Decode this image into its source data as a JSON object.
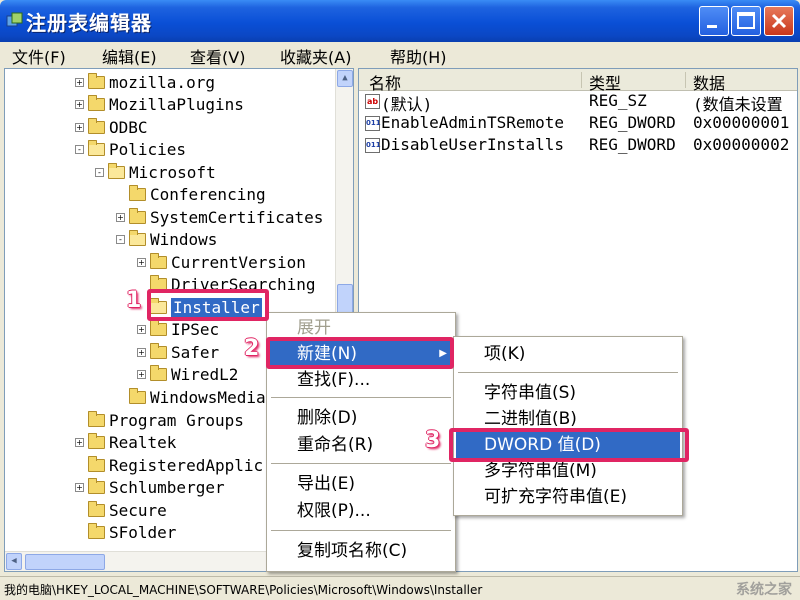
{
  "window": {
    "title": "注册表编辑器",
    "controls": {
      "minimize": "minimize",
      "maximize": "maximize",
      "close": "close"
    }
  },
  "menubar": [
    {
      "label": "文件(F)"
    },
    {
      "label": "编辑(E)"
    },
    {
      "label": "查看(V)"
    },
    {
      "label": "收藏夹(A)"
    },
    {
      "label": "帮助(H)"
    }
  ],
  "tree": [
    {
      "label": "mozilla.org",
      "expander": "+"
    },
    {
      "label": "MozillaPlugins",
      "expander": "+"
    },
    {
      "label": "ODBC",
      "expander": "+"
    },
    {
      "label": "Policies",
      "expander": "-"
    },
    {
      "label": "Microsoft",
      "expander": "-"
    },
    {
      "label": "Conferencing",
      "expander": ""
    },
    {
      "label": "SystemCertificates",
      "expander": "+"
    },
    {
      "label": "Windows",
      "expander": "-"
    },
    {
      "label": "CurrentVersion",
      "expander": "+"
    },
    {
      "label": "DriverSearching",
      "expander": ""
    },
    {
      "label": "Installer",
      "expander": "",
      "selected": true
    },
    {
      "label": "IPSec",
      "expander": "+"
    },
    {
      "label": "Safer",
      "expander": "+"
    },
    {
      "label": "WiredL2",
      "expander": "+"
    },
    {
      "label": "WindowsMedia",
      "expander": ""
    },
    {
      "label": "Program Groups",
      "expander": ""
    },
    {
      "label": "Realtek",
      "expander": "+"
    },
    {
      "label": "RegisteredApplic",
      "expander": ""
    },
    {
      "label": "Schlumberger",
      "expander": "+"
    },
    {
      "label": "Secure",
      "expander": ""
    },
    {
      "label": "SFolder",
      "expander": ""
    }
  ],
  "list": {
    "columns": [
      "名称",
      "类型",
      "数据"
    ],
    "rows": [
      {
        "name": "(默认)",
        "type": "REG_SZ",
        "data": "(数值未设置",
        "icon": "ab"
      },
      {
        "name": "EnableAdminTSRemote",
        "type": "REG_DWORD",
        "data": "0x00000001",
        "icon": "011"
      },
      {
        "name": "DisableUserInstalls",
        "type": "REG_DWORD",
        "data": "0x00000002",
        "icon": "011"
      }
    ]
  },
  "context_menu": {
    "items": [
      {
        "label": "展开",
        "state": "disabled"
      },
      {
        "label": "新建(N)",
        "state": "highlight",
        "submenu": true
      },
      {
        "label": "查找(F)...",
        "state": "normal"
      },
      {
        "label": "删除(D)",
        "state": "normal"
      },
      {
        "label": "重命名(R)",
        "state": "normal"
      },
      {
        "label": "导出(E)",
        "state": "normal"
      },
      {
        "label": "权限(P)...",
        "state": "normal"
      },
      {
        "label": "复制项名称(C)",
        "state": "normal"
      }
    ]
  },
  "submenu": {
    "items": [
      {
        "label": "项(K)",
        "state": "normal"
      },
      {
        "label": "字符串值(S)",
        "state": "normal"
      },
      {
        "label": "二进制值(B)",
        "state": "normal"
      },
      {
        "label": "DWORD 值(D)",
        "state": "highlight"
      },
      {
        "label": "多字符串值(M)",
        "state": "normal"
      },
      {
        "label": "可扩充字符串值(E)",
        "state": "normal"
      }
    ]
  },
  "annotations": [
    "1",
    "2",
    "3"
  ],
  "statusbar": {
    "path": "我的电脑\\HKEY_LOCAL_MACHINE\\SOFTWARE\\Policies\\Microsoft\\Windows\\Installer",
    "watermark": "系统之家"
  },
  "colors": {
    "highlight": "#316AC5",
    "annotation": "#E02563",
    "titlebar": "#0A4FD6"
  }
}
